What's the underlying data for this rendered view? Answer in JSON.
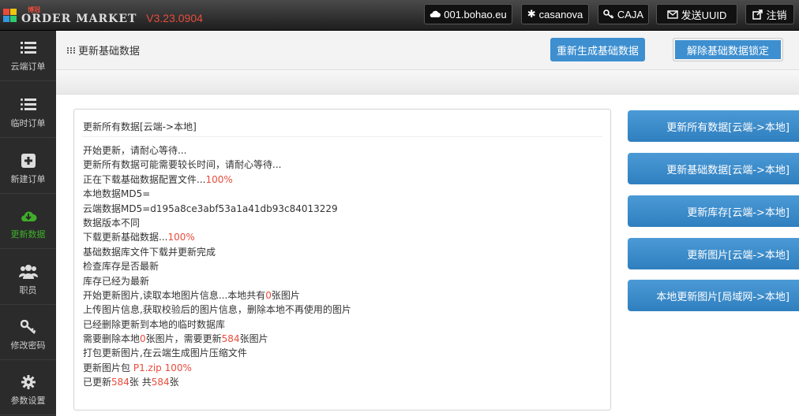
{
  "app": {
    "logo_small": "博冠",
    "logo_text": "ORDER MARKET",
    "version": "V3.23.0904"
  },
  "topbar": {
    "domain": "001.bohao.eu",
    "user": "casanova",
    "caja": "CAJA",
    "send_uuid": "发送UUID",
    "logout": "注销"
  },
  "sidebar": {
    "items": [
      {
        "label": "云端订单",
        "icon": "list-icon"
      },
      {
        "label": "临时订单",
        "icon": "list-icon"
      },
      {
        "label": "新建订单",
        "icon": "plus-square-icon"
      },
      {
        "label": "更新数据",
        "icon": "cloud-download-icon",
        "active": true
      },
      {
        "label": "职员",
        "icon": "users-icon"
      },
      {
        "label": "修改密码",
        "icon": "key-icon"
      },
      {
        "label": "参数设置",
        "icon": "gear-icon"
      }
    ]
  },
  "header": {
    "title": "更新基础数据",
    "regen_button": "重新生成基础数据",
    "unlock_button": "解除基础数据锁定"
  },
  "panel": {
    "title": "更新所有数据[云端->本地]",
    "log": [
      {
        "text": "开始更新，请耐心等待..."
      },
      {
        "text": "更新所有数据可能需要较长时间，请耐心等待..."
      },
      {
        "text": "正在下载基础数据配置文件...",
        "hl": "100%"
      },
      {
        "text": "本地数据MD5="
      },
      {
        "text": "云端数据MD5=d195a8ce3abf53a1a41db93c84013229"
      },
      {
        "text": "数据版本不同"
      },
      {
        "text": "下载更新基础数据...",
        "hl": "100%"
      },
      {
        "text": "基础数据库文件下载并更新完成"
      },
      {
        "text": "检查库存是否最新"
      },
      {
        "text": "库存已经为最新"
      },
      {
        "text": "开始更新图片,读取本地图片信息...本地共有",
        "hl": "0",
        "after": "张图片"
      },
      {
        "text": "上传图片信息,获取校验后的图片信息，删除本地不再使用的图片"
      },
      {
        "text": "已经删除更新到本地的临时数据库"
      },
      {
        "text": "需要删除本地",
        "hl": "0",
        "after": "张图片，需要更新",
        "hl2": "584",
        "after2": "张图片"
      },
      {
        "text": "打包更新图片,在云端生成图片压缩文件"
      },
      {
        "text": "更新图片包 ",
        "hl": "P1.zip 100%"
      },
      {
        "text": "已更新",
        "hl": "584",
        "after": "张 共",
        "hl2": "584",
        "after2": "张"
      }
    ]
  },
  "actions": [
    "更新所有数据[云端->本地]",
    "更新基础数据[云端->本地]",
    "更新库存[云端->本地]",
    "更新图片[云端->本地]",
    "本地更新图片[局域网->本地]"
  ],
  "colors": {
    "accent_blue": "#3d8fd0",
    "highlight_red": "#e74c3c",
    "active_green": "#3fae2a",
    "sidebar_bg": "#2b2b2b"
  }
}
